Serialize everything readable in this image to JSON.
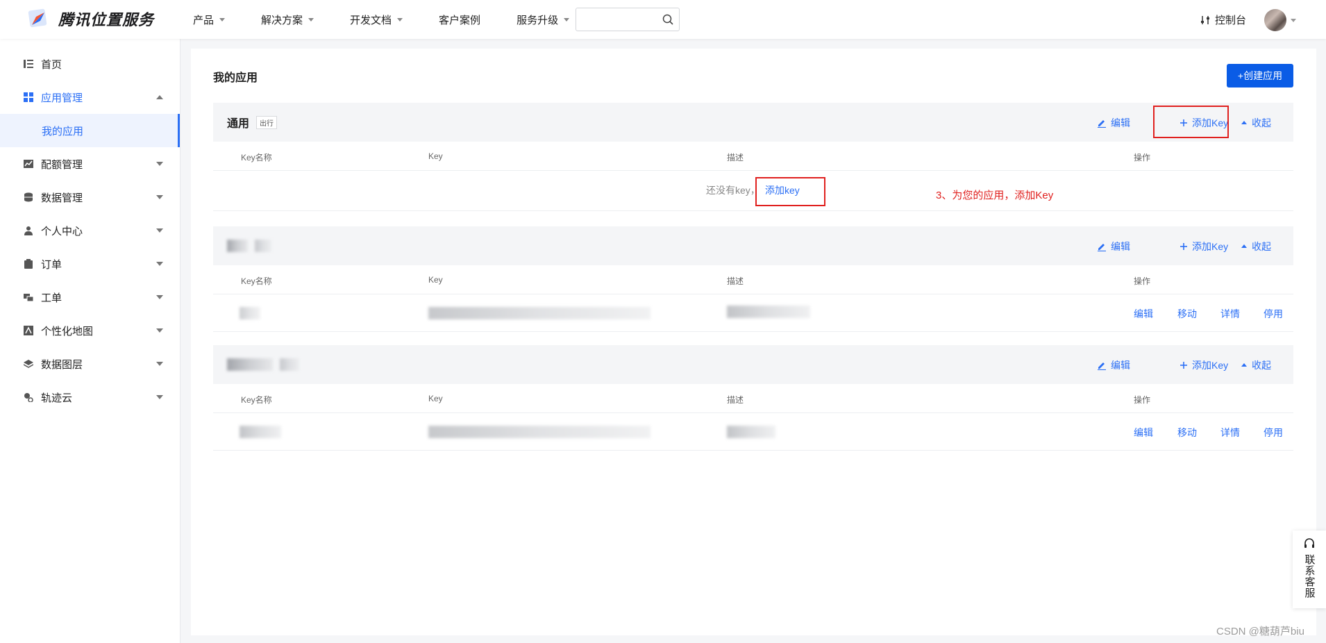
{
  "header": {
    "brand": "腾讯位置服务",
    "nav": [
      {
        "label": "产品",
        "dropdown": true
      },
      {
        "label": "解决方案",
        "dropdown": true
      },
      {
        "label": "开发文档",
        "dropdown": true
      },
      {
        "label": "客户案例",
        "dropdown": false
      },
      {
        "label": "服务升级",
        "dropdown": true
      }
    ],
    "search": {
      "value": "",
      "placeholder": ""
    },
    "console_label": "控制台"
  },
  "sidebar": {
    "items": [
      {
        "label": "首页",
        "icon": "list-icon"
      },
      {
        "label": "应用管理",
        "icon": "grid-icon",
        "expanded": true
      },
      {
        "label": "我的应用",
        "sub": true
      },
      {
        "label": "配额管理",
        "icon": "chart-icon"
      },
      {
        "label": "数据管理",
        "icon": "database-icon"
      },
      {
        "label": "个人中心",
        "icon": "user-icon"
      },
      {
        "label": "订单",
        "icon": "clipboard-icon"
      },
      {
        "label": "工单",
        "icon": "ticket-icon"
      },
      {
        "label": "个性化地图",
        "icon": "map-icon"
      },
      {
        "label": "数据图层",
        "icon": "layers-icon"
      },
      {
        "label": "轨迹云",
        "icon": "track-icon"
      }
    ]
  },
  "main": {
    "title": "我的应用",
    "create_button": "+创建应用",
    "columns": {
      "key_name": "Key名称",
      "key": "Key",
      "desc": "描述",
      "ops": "操作"
    },
    "group_actions": {
      "edit": "编辑",
      "add_key": "添加Key",
      "collapse": "收起"
    },
    "row_ops": {
      "edit": "编辑",
      "move": "移动",
      "detail": "详情",
      "disable": "停用"
    },
    "groups": [
      {
        "name": "通用",
        "tag": "出行",
        "empty_text": "还没有key，",
        "empty_link": "添加key"
      }
    ],
    "annotation": "3、为您的应用，添加Key"
  },
  "customer_service": "联系客服",
  "watermark": "CSDN @糖葫芦biu",
  "colors": {
    "accent": "#2b6ff5",
    "button": "#0a5ce6",
    "annotation": "#e0201e"
  }
}
